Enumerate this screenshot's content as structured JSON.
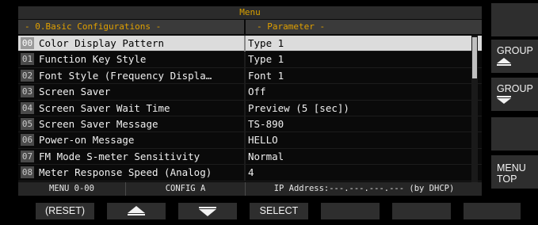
{
  "menu": {
    "title": "Menu",
    "left_header": "- 0.Basic Configurations -",
    "right_header": "- Parameter -",
    "rows": [
      {
        "num": "00",
        "name": "Color Display Pattern",
        "value": "Type 1",
        "selected": true
      },
      {
        "num": "01",
        "name": "Function Key Style",
        "value": "Type 1"
      },
      {
        "num": "02",
        "name": "Font Style (Frequency Displa…",
        "value": "Font 1"
      },
      {
        "num": "03",
        "name": "Screen Saver",
        "value": "Off"
      },
      {
        "num": "04",
        "name": "Screen Saver Wait Time",
        "value": "Preview (5 [sec])"
      },
      {
        "num": "05",
        "name": "Screen Saver Message",
        "value": "TS-890"
      },
      {
        "num": "06",
        "name": "Power-on Message",
        "value": "HELLO"
      },
      {
        "num": "07",
        "name": "FM Mode S-meter Sensitivity",
        "value": "Normal"
      },
      {
        "num": "08",
        "name": "Meter Response Speed (Analog)",
        "value": "4"
      }
    ]
  },
  "status": {
    "menu_number": "MENU 0-00",
    "config": "CONFIG A",
    "ip": "IP Address:---.---.---.--- (by DHCP)"
  },
  "side_buttons": {
    "group_up": {
      "label": "GROUP",
      "icon": "arrow-up-icon"
    },
    "group_down": {
      "label": "GROUP",
      "icon": "arrow-down-icon"
    },
    "menu_top": {
      "label_line1": "MENU",
      "label_line2": "TOP"
    }
  },
  "soft_keys": {
    "reset": "(RESET)",
    "up_icon": "arrow-up-icon",
    "down_icon": "arrow-down-icon",
    "select": "SELECT"
  },
  "colors": {
    "header_text": "#e0a000",
    "selected_row": "#dcdcdc",
    "button_bg": "#2e2e2e"
  }
}
